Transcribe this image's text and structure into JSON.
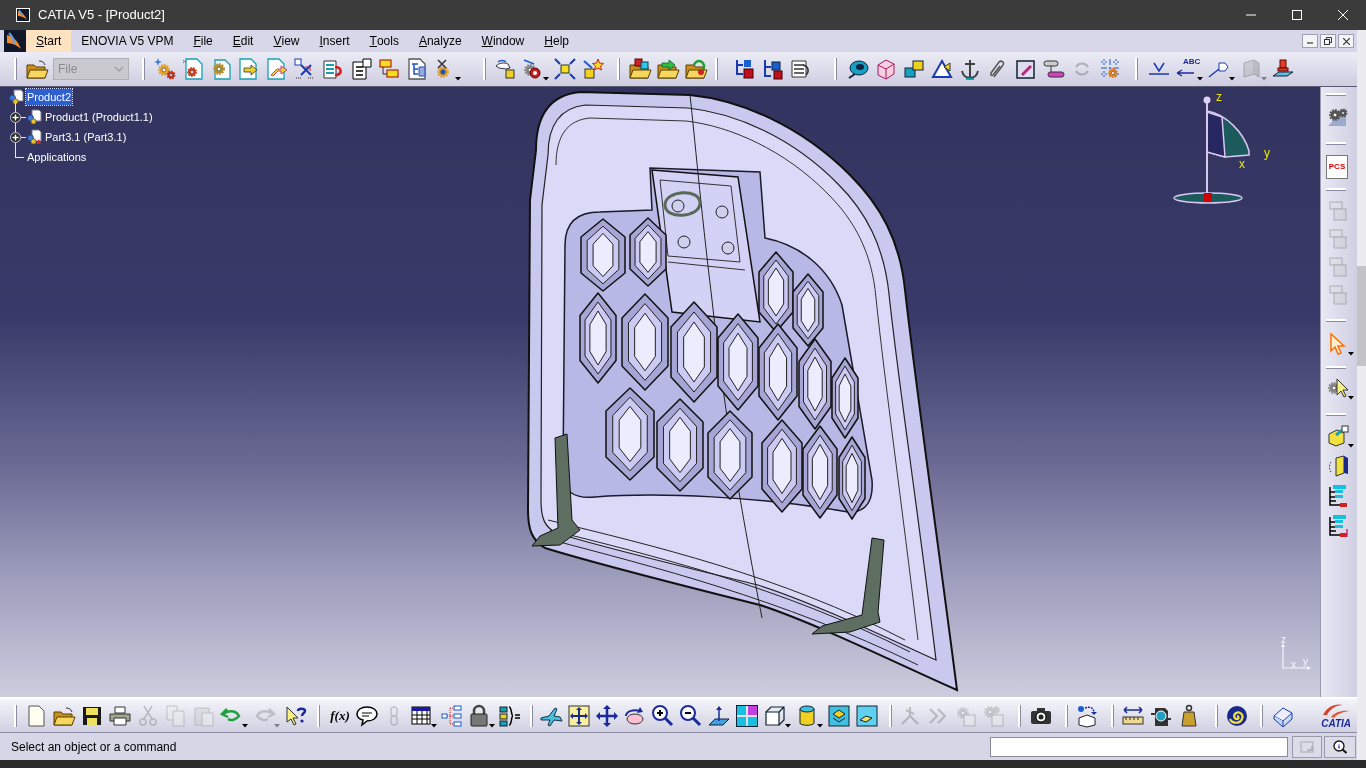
{
  "window": {
    "title": "CATIA V5 - [Product2]"
  },
  "menu": [
    {
      "label": "Start",
      "selected": true,
      "access_key": true
    },
    {
      "label": "ENOVIA V5 VPM",
      "selected": false,
      "access_key": false
    },
    {
      "label": "File",
      "selected": false,
      "access_key": true
    },
    {
      "label": "Edit",
      "selected": false,
      "access_key": true
    },
    {
      "label": "View",
      "selected": false,
      "access_key": true
    },
    {
      "label": "Insert",
      "selected": false,
      "access_key": true
    },
    {
      "label": "Tools",
      "selected": false,
      "access_key": true
    },
    {
      "label": "Analyze",
      "selected": false,
      "access_key": true
    },
    {
      "label": "Window",
      "selected": false,
      "access_key": true
    },
    {
      "label": "Help",
      "selected": false,
      "access_key": true
    }
  ],
  "top_toolbar": {
    "file_combo": {
      "value": "File",
      "disabled": true
    },
    "groups": [
      [
        {
          "disabled": false
        }
      ],
      [
        {
          "disabled": false
        },
        {
          "disabled": false
        },
        {
          "disabled": false
        },
        {
          "disabled": false
        },
        {
          "disabled": false
        },
        {
          "disabled": false
        },
        {
          "disabled": false
        },
        {
          "disabled": false
        },
        {
          "disabled": false
        },
        {
          "disabled": false
        },
        {
          "disabled": false
        }
      ],
      [
        {
          "disabled": false
        },
        {
          "disabled": false
        },
        {
          "disabled": false
        },
        {
          "disabled": false
        }
      ],
      [
        {
          "disabled": false
        },
        {
          "disabled": false
        },
        {
          "disabled": false
        }
      ],
      [
        {
          "disabled": false
        },
        {
          "disabled": false
        },
        {
          "disabled": false
        }
      ],
      [
        {
          "disabled": false
        },
        {
          "disabled": false
        },
        {
          "disabled": false
        },
        {
          "disabled": false
        },
        {
          "disabled": false
        },
        {
          "disabled": false
        },
        {
          "disabled": false
        },
        {
          "disabled": false
        },
        {
          "disabled": true
        },
        {
          "disabled": false
        }
      ],
      [
        {
          "disabled": false
        },
        {
          "disabled": false,
          "label": "ABC"
        },
        {
          "disabled": false
        },
        {
          "disabled": true
        },
        {
          "disabled": false
        }
      ]
    ]
  },
  "tree": {
    "label": "Product2",
    "kind": "product",
    "selected": true,
    "children": [
      {
        "label": "Product1 (Product1.1)",
        "kind": "product",
        "selected": false,
        "expanded": false
      },
      {
        "label": "Part3.1 (Part3.1)",
        "kind": "part",
        "selected": false,
        "expanded": false
      },
      {
        "label": "Applications",
        "kind": "plain",
        "selected": false
      }
    ]
  },
  "compass": {
    "labels": [
      "z",
      "y",
      "x"
    ]
  },
  "axis_triad": {
    "labels": [
      "z",
      "x",
      "y"
    ]
  },
  "right_toolbar": {
    "groups": [
      [
        {
          "disabled": false
        }
      ],
      [
        {
          "disabled": false,
          "label": "PCS"
        }
      ],
      [
        {
          "disabled": true
        },
        {
          "disabled": true
        },
        {
          "disabled": true
        },
        {
          "disabled": true
        }
      ],
      [
        {
          "disabled": false
        }
      ],
      [
        {
          "disabled": false
        }
      ],
      [
        {
          "disabled": false
        },
        {
          "disabled": false
        },
        {
          "disabled": false
        },
        {
          "disabled": false
        }
      ]
    ]
  },
  "bottom_toolbar": {
    "groups": [
      [
        {
          "disabled": false
        },
        {
          "disabled": false
        },
        {
          "disabled": false
        },
        {
          "disabled": false
        },
        {
          "disabled": true
        },
        {
          "disabled": true
        },
        {
          "disabled": true
        },
        {
          "disabled": false
        },
        {
          "disabled": true
        },
        {
          "disabled": false
        }
      ],
      [
        {
          "disabled": false,
          "label": "f(x)"
        },
        {
          "disabled": false
        },
        {
          "disabled": true
        },
        {
          "disabled": false
        },
        {
          "disabled": false
        },
        {
          "disabled": false
        },
        {
          "disabled": false
        }
      ],
      [
        {
          "disabled": false
        },
        {
          "disabled": false
        },
        {
          "disabled": false
        },
        {
          "disabled": false
        },
        {
          "disabled": false
        },
        {
          "disabled": false
        },
        {
          "disabled": false
        },
        {
          "disabled": false
        },
        {
          "disabled": false
        },
        {
          "disabled": false
        },
        {
          "disabled": false
        },
        {
          "disabled": false
        }
      ],
      [
        {
          "disabled": true
        },
        {
          "disabled": true
        },
        {
          "disabled": true
        },
        {
          "disabled": true
        }
      ],
      [
        {
          "disabled": false
        }
      ],
      [
        {
          "disabled": false
        }
      ],
      [
        {
          "disabled": false
        },
        {
          "disabled": false
        },
        {
          "disabled": false
        }
      ],
      [
        {
          "disabled": false
        }
      ],
      [
        {
          "disabled": false
        }
      ]
    ],
    "logo": {
      "text": "CATIA"
    }
  },
  "status_bar": {
    "message": "Select an object or a command",
    "buttons": [
      {
        "disabled": true
      },
      {
        "disabled": false
      }
    ]
  }
}
